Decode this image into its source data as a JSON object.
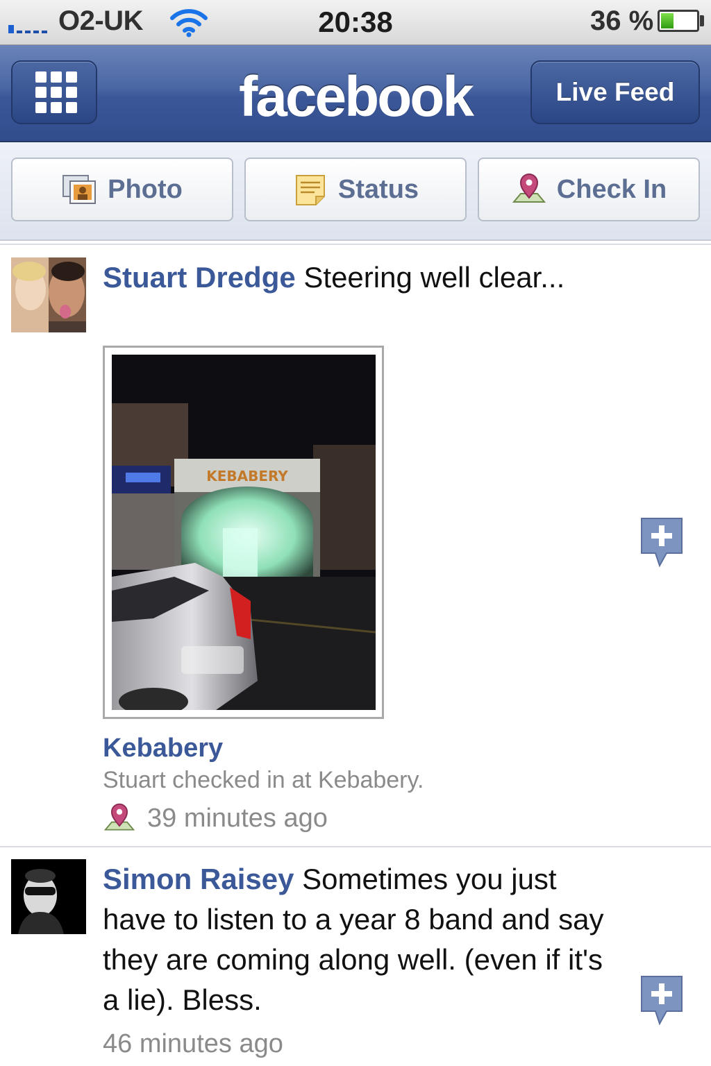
{
  "status_bar": {
    "carrier": "O2-UK",
    "time": "20:38",
    "battery_percent": "36 %",
    "battery_level": 0.36
  },
  "nav": {
    "logo": "facebook",
    "live_feed_label": "Live Feed"
  },
  "publisher": {
    "photo_label": "Photo",
    "status_label": "Status",
    "checkin_label": "Check In"
  },
  "feed": {
    "stories": [
      {
        "author": "Stuart Dredge",
        "message": " Steering well clear...",
        "place_name": "Kebabery",
        "place_subtitle": "Stuart checked in at Kebabery.",
        "time": "39 minutes ago",
        "shop_sign": "KEBABERY"
      },
      {
        "author": "Simon Raisey",
        "message": " Sometimes you just have to listen to a year 8 band and say they are coming along well. (even if it's a lie). Bless.",
        "time": "46 minutes ago"
      }
    ]
  },
  "colors": {
    "brand_blue": "#3b5998",
    "nav_dark": "#314d8c",
    "secondary_text": "#8a8a8a"
  },
  "icons": [
    "signal-icon",
    "wifi-icon",
    "battery-icon",
    "grid-menu-icon",
    "photo-icon",
    "status-note-icon",
    "checkin-pin-icon",
    "add-comment-icon"
  ]
}
